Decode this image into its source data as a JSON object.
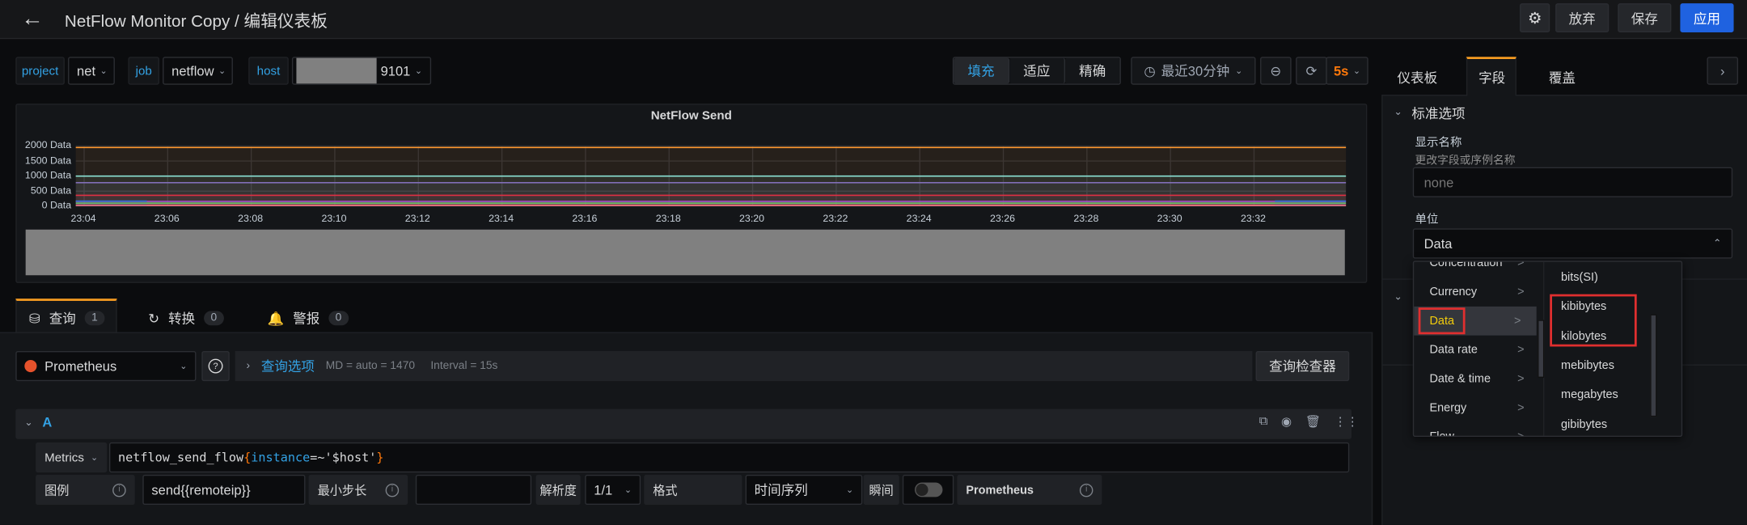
{
  "header": {
    "title": "NetFlow Monitor Copy / 编辑仪表板",
    "back_icon": "arrow-left-icon",
    "settings_icon": "gear-icon",
    "discard": "放弃",
    "save": "保存",
    "apply": "应用",
    "apply_color": "#1f62e0"
  },
  "variables": [
    {
      "label": "project",
      "value": "net"
    },
    {
      "label": "job",
      "value": "netflow"
    },
    {
      "label": "host",
      "value": "9101"
    }
  ],
  "toolbar": {
    "fill": "填充",
    "fit": "适应",
    "exact": "精确",
    "time_range": "最近30分钟",
    "refresh_interval": "5s",
    "refresh_color": "#ff780a"
  },
  "chart_data": {
    "type": "line",
    "title": "NetFlow Send",
    "y_unit": "Data",
    "ylim": [
      0,
      2000
    ],
    "yticks": [
      "0 Data",
      "500 Data",
      "1000 Data",
      "1500 Data",
      "2000 Data"
    ],
    "yticks_values": [
      0,
      500,
      1000,
      1500,
      2000
    ],
    "xticks": [
      "23:04",
      "23:06",
      "23:08",
      "23:10",
      "23:12",
      "23:14",
      "23:16",
      "23:18",
      "23:20",
      "23:22",
      "23:24",
      "23:26",
      "23:28",
      "23:30",
      "23:32"
    ],
    "xlim": [
      "23:03:48",
      "23:34:12"
    ],
    "grid": true,
    "fill": true,
    "series": [
      {
        "color": "#ff9830",
        "x": [
          "23:03:48",
          "23:34:12"
        ],
        "values": [
          1950,
          1950
        ]
      },
      {
        "color": "#8ae1d4",
        "x": [
          "23:03:48",
          "23:34:12"
        ],
        "values": [
          1000,
          1000
        ]
      },
      {
        "color": "#806eb7",
        "x": [
          "23:03:48",
          "23:34:12"
        ],
        "values": [
          780,
          780
        ]
      },
      {
        "color": "#e02f44",
        "x": [
          "23:03:48",
          "23:34:12"
        ],
        "values": [
          360,
          360
        ]
      },
      {
        "color": "#a352cc",
        "x": [
          "23:03:48",
          "23:34:12"
        ],
        "values": [
          160,
          160
        ]
      },
      {
        "color": "#73bf69",
        "x": [
          "23:03:48",
          "23:34:12"
        ],
        "values": [
          100,
          100
        ]
      },
      {
        "color": "#ff7383",
        "x": [
          "23:03:48",
          "23:34:12"
        ],
        "values": [
          30,
          30
        ]
      },
      {
        "color": "#3274d9",
        "x": [
          "23:03:48",
          "23:05:30"
        ],
        "values": [
          170,
          170
        ]
      },
      {
        "color": "#3274d9",
        "x": [
          "23:32:30",
          "23:34:12"
        ],
        "values": [
          170,
          170
        ]
      }
    ]
  },
  "query_tabs": [
    {
      "label": "查询",
      "count": "1",
      "icon": "database-icon"
    },
    {
      "label": "转换",
      "count": "0",
      "icon": "transform-icon"
    },
    {
      "label": "警报",
      "count": "0",
      "icon": "bell-icon"
    }
  ],
  "datasource": {
    "name": "Prometheus",
    "options_label": "查询选项",
    "md": "MD = auto = 1470",
    "interval": "Interval = 15s",
    "inspector": "查询检查器"
  },
  "query": {
    "ref": "A",
    "metrics_label": "Metrics",
    "expr_metric": "netflow_send_flow",
    "expr_open": "{",
    "expr_label": "instance",
    "expr_op": "=~",
    "expr_value": "'$host'",
    "expr_close": "}",
    "legend_label": "图例",
    "legend_value": "send{{remoteip}}",
    "min_step_label": "最小步长",
    "min_step_value": "",
    "resolution_label": "解析度",
    "resolution_value": "1/1",
    "format_label": "格式",
    "format_value": "时间序列",
    "instant_label": "瞬间",
    "instant_on": false,
    "datasource_badge": "Prometheus"
  },
  "side_panel": {
    "tabs": [
      "仪表板",
      "字段",
      "覆盖"
    ],
    "active_tab": "字段",
    "section_title": "标准选项",
    "display_name_label": "显示名称",
    "display_name_desc": "更改字段或序例名称",
    "display_name_placeholder": "none",
    "unit_label": "单位",
    "unit_value": "Data",
    "categories": [
      {
        "label": "Concentration"
      },
      {
        "label": "Currency"
      },
      {
        "label": "Data",
        "selected": true
      },
      {
        "label": "Data rate"
      },
      {
        "label": "Date & time"
      },
      {
        "label": "Energy"
      },
      {
        "label": "Flow"
      }
    ],
    "arrow": ">",
    "units": [
      "bits(SI)",
      "kibibytes",
      "kilobytes",
      "mebibytes",
      "megabytes",
      "gibibytes"
    ],
    "highlight_color": "#e02f2f",
    "selected_color": "#f2cc0c"
  }
}
